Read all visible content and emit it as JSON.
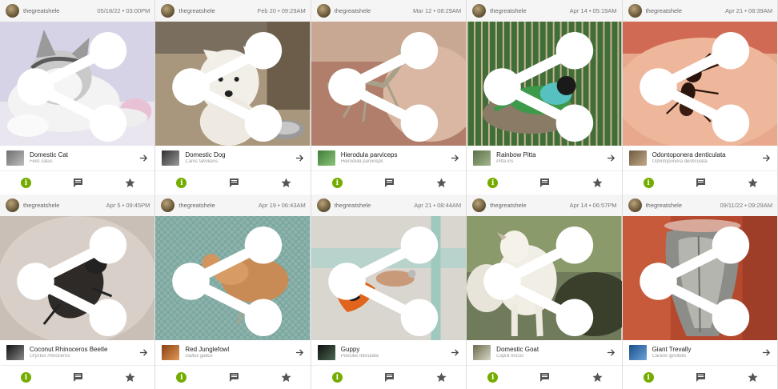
{
  "observations": [
    {
      "username": "thegreatshele",
      "timestamp": "05/18/22 • 03:00PM",
      "common_name": "Domestic Cat",
      "scientific_name": "Felis catus",
      "photo": "cat",
      "thumb_color": "#8d8d8d"
    },
    {
      "username": "thegreatshele",
      "timestamp": "Feb 20 • 09:29AM",
      "common_name": "Domestic Dog",
      "scientific_name": "Canis familiaris",
      "photo": "dog",
      "thumb_color": "#5a5a5a"
    },
    {
      "username": "thegreatshele",
      "timestamp": "Mar 12 • 08:29AM",
      "common_name": "Hierodula parviceps",
      "scientific_name": "Hierodula parviceps",
      "photo": "mantis",
      "thumb_color": "#4e9a45"
    },
    {
      "username": "thegreatshele",
      "timestamp": "Apr 14 • 05:19AM",
      "common_name": "Rainbow Pitta",
      "scientific_name": "Pitta iris",
      "photo": "pitta",
      "thumb_color": "#6e8a5a"
    },
    {
      "username": "thegreatshele",
      "timestamp": "Apr 21 • 08:39AM",
      "common_name": "Odontoponera denticulata",
      "scientific_name": "Odontoponera denticulata",
      "photo": "ant",
      "thumb_color": "#8b7458"
    },
    {
      "username": "thegreatshele",
      "timestamp": "Apr 5 • 09:45PM",
      "common_name": "Coconut Rhinoceros Beetle",
      "scientific_name": "Oryctes rhinoceros",
      "photo": "beetle",
      "thumb_color": "#2d2d2d"
    },
    {
      "username": "thegreatshele",
      "timestamp": "Apr 19 • 06:43AM",
      "common_name": "Red Junglefowl",
      "scientific_name": "Gallus gallus",
      "photo": "fowl",
      "thumb_color": "#b4632a"
    },
    {
      "username": "thegreatshele",
      "timestamp": "Apr 21 • 08:44AM",
      "common_name": "Guppy",
      "scientific_name": "Poecilia reticulata",
      "photo": "guppy",
      "thumb_color": "#1f1f1f"
    },
    {
      "username": "thegreatshele",
      "timestamp": "Apr 14 • 06:57PM",
      "common_name": "Domestic Goat",
      "scientific_name": "Capra hircus",
      "photo": "goat",
      "thumb_color": "#8f8f6e"
    },
    {
      "username": "thegreatshele",
      "timestamp": "09/11/22 • 09:29AM",
      "common_name": "Giant Trevally",
      "scientific_name": "Caranx ignobilis",
      "photo": "trevally",
      "thumb_color": "#2868a8"
    }
  ],
  "colors": {
    "accent": "#74ac00",
    "icon_gray": "#555555"
  },
  "icons": {
    "share": "share-icon",
    "arrow": "arrow-right-icon",
    "info": "info-icon",
    "comment": "comment-icon",
    "star": "star-icon"
  }
}
